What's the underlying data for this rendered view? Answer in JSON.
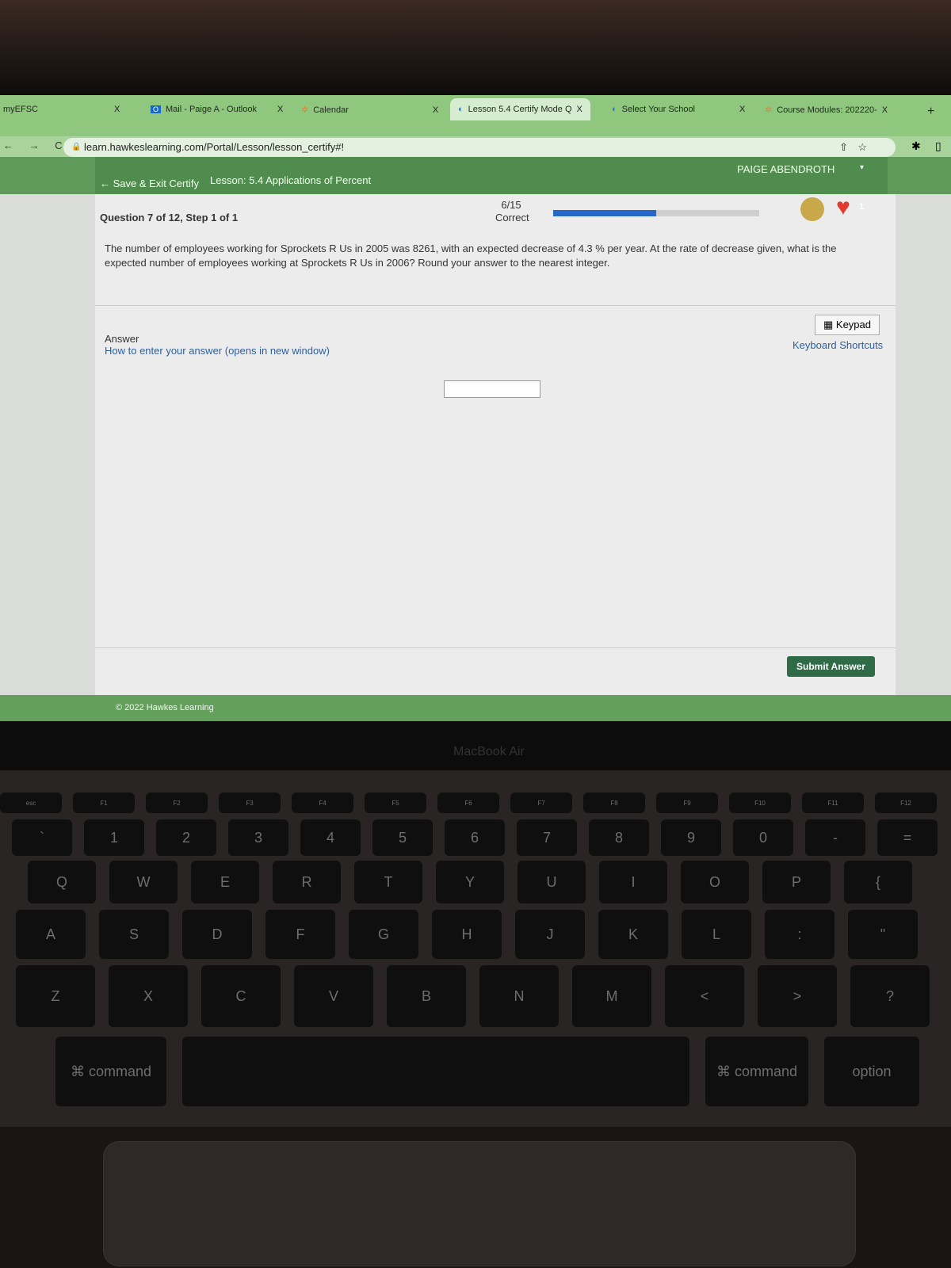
{
  "browser": {
    "tabs": [
      {
        "label": "myEFSC",
        "close": "X"
      },
      {
        "label": "Mail - Paige A - Outlook",
        "close": "X"
      },
      {
        "label": "Calendar",
        "close": "X"
      },
      {
        "label": "Lesson 5.4 Certify Mode Q",
        "close": "X",
        "active": true
      },
      {
        "label": "Select Your School",
        "close": "X"
      },
      {
        "label": "Course Modules: 202220-",
        "close": "X"
      }
    ],
    "new_tab": "+",
    "url": "learn.hawkeslearning.com/Portal/Lesson/lesson_certify#!",
    "nav": "← → C"
  },
  "header": {
    "save_exit": "← Save & Exit Certify",
    "lesson": "Lesson: 5.4 Applications of Percent",
    "user": "PAIGE ABENDROTH",
    "user_caret": "▾"
  },
  "status": {
    "question": "Question 7 of 12, Step 1 of 1",
    "score": "6/15",
    "score_label": "Correct",
    "progress_fraction": 0.5,
    "hearts": "1"
  },
  "question": {
    "text": "The number of employees working for Sprockets R Us in 2005 was 8261, with an expected decrease of 4.3 % per year. At the rate of decrease given, what is the expected number of employees working at Sprockets R Us in 2006? Round your answer to the nearest integer."
  },
  "answer": {
    "label": "Answer",
    "help_link": "How to enter your answer (opens in new window)",
    "keypad": "Keypad",
    "shortcuts": "Keyboard Shortcuts",
    "value": "",
    "submit": "Submit Answer"
  },
  "footer": {
    "copyright": "© 2022 Hawkes Learning"
  },
  "device": {
    "brand": "MacBook Air"
  },
  "keyboard": {
    "rows": [
      [
        "esc",
        "F1",
        "F2",
        "F3",
        "F4",
        "F5",
        "F6",
        "F7",
        "F8",
        "F9",
        "F10",
        "F11",
        "F12"
      ],
      [
        "`",
        "1",
        "2",
        "3",
        "4",
        "5",
        "6",
        "7",
        "8",
        "9",
        "0",
        "-",
        "="
      ],
      [
        "Q",
        "W",
        "E",
        "R",
        "T",
        "Y",
        "U",
        "I",
        "O",
        "P",
        "{"
      ],
      [
        "A",
        "S",
        "D",
        "F",
        "G",
        "H",
        "J",
        "K",
        "L",
        ":",
        "\""
      ],
      [
        "Z",
        "X",
        "C",
        "V",
        "B",
        "N",
        "M",
        "<",
        ">",
        "?"
      ],
      [
        "⌘ command",
        "",
        "⌘ command",
        "option"
      ]
    ]
  },
  "colors": {
    "tab_bar": "#8fc77f",
    "header": "#4f8c4d",
    "progress": "#2568c9",
    "submit": "#2f6b47"
  }
}
